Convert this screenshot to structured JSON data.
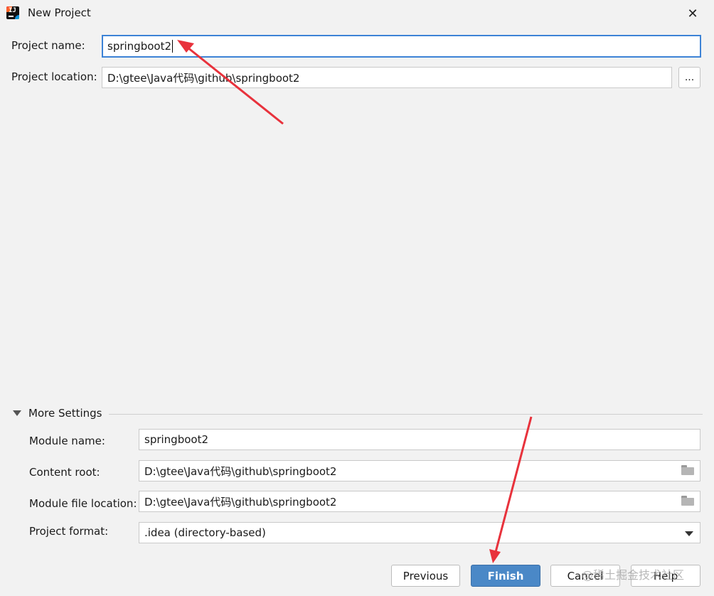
{
  "window": {
    "title": "New Project",
    "close_glyph": "✕"
  },
  "project_name": {
    "label": "Project name:",
    "value": "springboot2"
  },
  "project_location": {
    "label": "Project location:",
    "value": "D:\\gtee\\Java代码\\github\\springboot2",
    "browse_label": "..."
  },
  "more_settings": {
    "label": "More Settings",
    "module_name": {
      "label": "Module name:",
      "value": "springboot2"
    },
    "content_root": {
      "label": "Content root:",
      "value": "D:\\gtee\\Java代码\\github\\springboot2"
    },
    "module_file_location": {
      "label": "Module file location:",
      "value": "D:\\gtee\\Java代码\\github\\springboot2"
    },
    "project_format": {
      "label": "Project format:",
      "value": ".idea (directory-based)"
    }
  },
  "buttons": {
    "previous": "Previous",
    "finish": "Finish",
    "cancel": "Cancel",
    "help": "Help"
  },
  "watermark": "@稀土掘金技术社区",
  "colors": {
    "focus_border": "#3d83d6",
    "primary_button": "#4a88c7",
    "annotation_arrow": "#e8323c"
  },
  "icons": {
    "app": "intellij-idea-icon",
    "browse_folder": "folder-icon",
    "expand": "triangle-down-icon",
    "dropdown": "chevron-down-icon"
  }
}
